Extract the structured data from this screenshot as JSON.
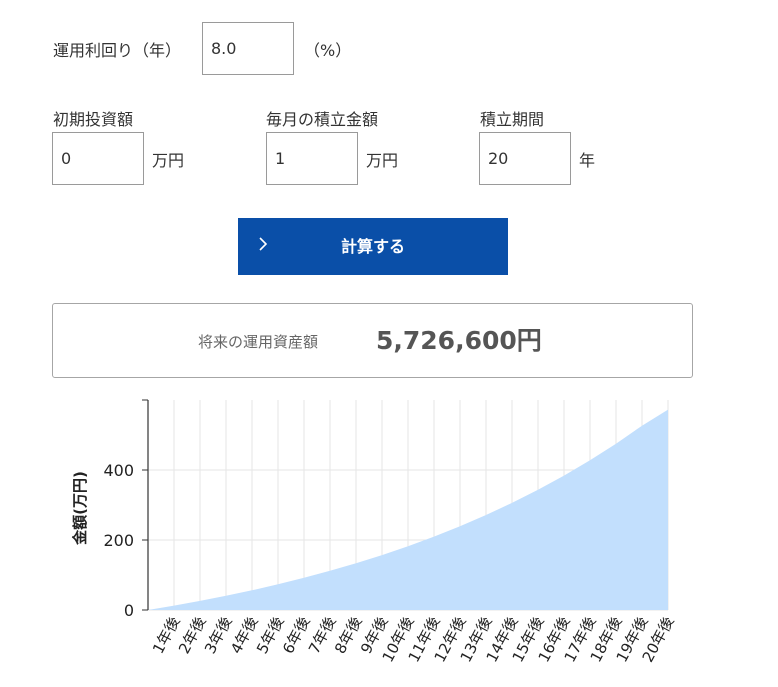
{
  "form": {
    "rate_label": "運用利回り（年）",
    "rate_value": "8.0",
    "rate_unit": "（%）",
    "initial_label": "初期投資額",
    "initial_value": "0",
    "initial_unit": "万円",
    "monthly_label": "毎月の積立金額",
    "monthly_value": "1",
    "monthly_unit": "万円",
    "period_label": "積立期間",
    "period_value": "20",
    "period_unit": "年",
    "calc_button": "計算する"
  },
  "result": {
    "label": "将来の運用資産額",
    "value": "5,726,600円"
  },
  "colors": {
    "button": "#0a4fa8",
    "area_fill": "#c2dffd",
    "text": "#333333"
  },
  "chart_data": {
    "type": "area",
    "ylabel": "金額(万円)",
    "yticks": [
      0,
      200,
      400
    ],
    "ylim": [
      0,
      600
    ],
    "categories": [
      "1年後",
      "2年後",
      "3年後",
      "4年後",
      "5年後",
      "6年後",
      "7年後",
      "8年後",
      "9年後",
      "10年後",
      "11年後",
      "12年後",
      "13年後",
      "14年後",
      "15年後",
      "16年後",
      "17年後",
      "18年後",
      "19年後",
      "20年後"
    ],
    "series": [
      {
        "values": [
          12.5,
          26.0,
          40.6,
          56.4,
          73.5,
          92.0,
          112.0,
          133.6,
          157.0,
          182.3,
          209.7,
          239.3,
          271.3,
          305.9,
          343.4,
          383.9,
          427.7,
          475.2,
          526.5,
          572.7
        ]
      }
    ]
  }
}
